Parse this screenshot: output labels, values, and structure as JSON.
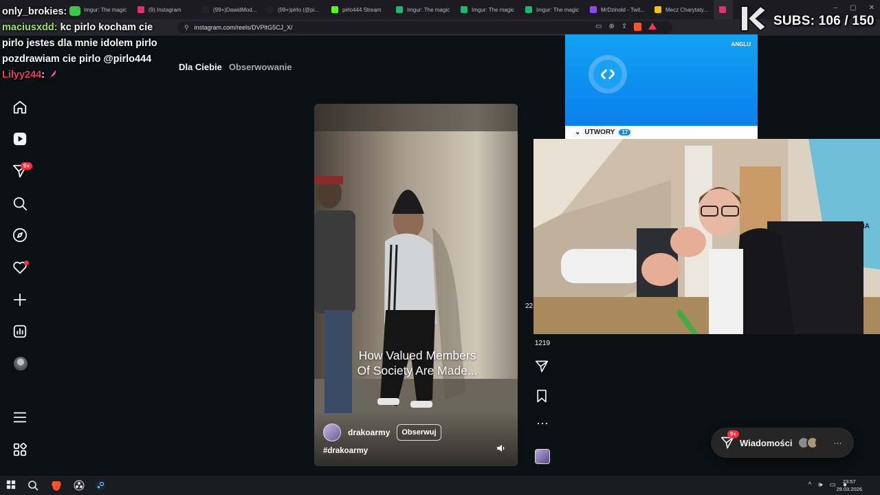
{
  "browser": {
    "tabs": [
      {
        "label": "Imgur: The magic",
        "icon_color": "#1bb76e"
      },
      {
        "label": "(9) Instagram",
        "icon_color": "#e1306c"
      },
      {
        "label": "(99+)DawidMod...",
        "icon_color": "#222222"
      },
      {
        "label": "(99+)pirlo (@pi...",
        "icon_color": "#222222"
      },
      {
        "label": "pirlo444 Stream",
        "icon_color": "#53fc18"
      },
      {
        "label": "Imgur: The magic",
        "icon_color": "#1bb76e"
      },
      {
        "label": "Imgur: The magic",
        "icon_color": "#1bb76e"
      },
      {
        "label": "Imgur: The magic",
        "icon_color": "#1bb76e"
      },
      {
        "label": "MrDzinold - Twit...",
        "icon_color": "#9146ff"
      },
      {
        "label": "Mecz Charytaty...",
        "icon_color": "#f5c400"
      }
    ],
    "url": "instagram.com/reels/DVPltG5CJ_X/"
  },
  "chat": [
    {
      "user": "only_brokies:",
      "message": ""
    },
    {
      "user": "maciusxdd:",
      "message": "kc pirlo kocham cie pirlo jestes dla mnie idolem pirlo pozdrawiam cie pirlo @pirlo444"
    },
    {
      "user": "Lilyy244",
      "message": ":"
    }
  ],
  "sidebar": {
    "notification_badge": "9+"
  },
  "feed": {
    "tabs": [
      "Dla Ciebie",
      "Obserwowanie"
    ]
  },
  "reel": {
    "caption_line1": "How Valued Members",
    "caption_line2": "Of Society Are Made...",
    "author": "drakoarmy",
    "follow_label": "Obserwuj",
    "hashtag": "#drakoarmy",
    "partial_count": "22",
    "comments": "1219"
  },
  "shazam": {
    "section": "UTWORY",
    "count": "17",
    "lang": "ANGLU"
  },
  "stream": {
    "subs": "SUBS: 106 / 150"
  },
  "messages": {
    "label": "Wiadomości",
    "badge": "9+"
  },
  "taskbar": {
    "time": "23:57",
    "date": "29.03.2026"
  }
}
